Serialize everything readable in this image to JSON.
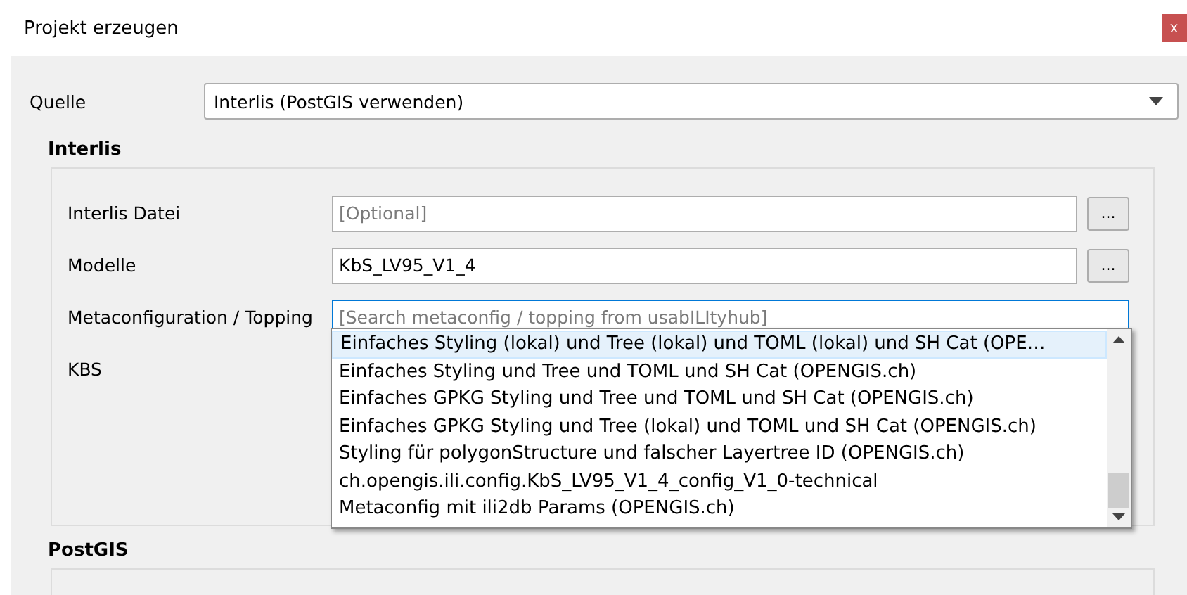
{
  "window": {
    "title": "Projekt erzeugen",
    "close": "x"
  },
  "source": {
    "label": "Quelle",
    "value": "Interlis (PostGIS verwenden)"
  },
  "interlis": {
    "title": "Interlis",
    "fields": [
      {
        "label": "Interlis Datei",
        "placeholder": "[Optional]",
        "browse": "..."
      },
      {
        "label": "Modelle",
        "value": "KbS_LV95_V1_4",
        "browse": "..."
      },
      {
        "label": "Metaconfiguration / Topping",
        "placeholder": "[Search metaconfig / topping from usabILItyhub]",
        "focused": true
      },
      {
        "label": "KBS"
      }
    ],
    "suggestions": [
      {
        "text": "Einfaches Styling (lokal) und Tree (lokal) und TOML (lokal) und SH Cat (OPE…",
        "selected": true
      },
      {
        "text": "Einfaches Styling und Tree und TOML und SH Cat (OPENGIS.ch)",
        "selected": false
      },
      {
        "text": "Einfaches GPKG Styling und Tree und TOML und SH Cat (OPENGIS.ch)",
        "selected": false
      },
      {
        "text": "Einfaches GPKG Styling und Tree (lokal) und TOML und SH Cat (OPENGIS.ch)",
        "selected": false
      },
      {
        "text": "Styling für polygonStructure und falscher Layertree ID (OPENGIS.ch)",
        "selected": false
      },
      {
        "text": "ch.opengis.ili.config.KbS_LV95_V1_4_config_V1_0-technical",
        "selected": false
      },
      {
        "text": "Metaconfig mit ili2db Params (OPENGIS.ch)",
        "selected": false
      }
    ]
  },
  "postgis": {
    "title": "PostGIS"
  }
}
